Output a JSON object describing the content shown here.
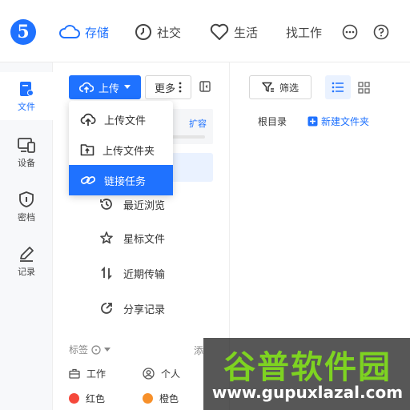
{
  "brand": {
    "logo_text": "5",
    "accent": "#1f72ff"
  },
  "nav": {
    "items": [
      {
        "label": "存储",
        "icon": "cloud-icon",
        "active": true
      },
      {
        "label": "社交",
        "icon": "clock-icon"
      },
      {
        "label": "生活",
        "icon": "heart-icon"
      },
      {
        "label": "找工作"
      }
    ],
    "more_icon": "more-dots-icon",
    "help_icon": "help-icon"
  },
  "rail": {
    "items": [
      {
        "label": "文件",
        "icon": "file-icon",
        "active": true
      },
      {
        "label": "设备",
        "icon": "devices-icon"
      },
      {
        "label": "密档",
        "icon": "shield-icon"
      },
      {
        "label": "记录",
        "icon": "pen-icon"
      }
    ]
  },
  "toolbar": {
    "upload_label": "上传",
    "more_label": "更多"
  },
  "upload_menu": {
    "items": [
      {
        "label": "上传文件",
        "icon": "cloud-upload-icon"
      },
      {
        "label": "上传文件夹",
        "icon": "folder-upload-icon"
      },
      {
        "label": "链接任务",
        "icon": "link-icon",
        "active": true
      }
    ]
  },
  "storage": {
    "expand_label": "扩容"
  },
  "side_menu": {
    "items": [
      {
        "label": "最近浏览",
        "icon": "history-icon"
      },
      {
        "label": "星标文件",
        "icon": "star-icon"
      },
      {
        "label": "近期传输",
        "icon": "transfer-icon"
      },
      {
        "label": "分享记录",
        "icon": "share-icon"
      }
    ]
  },
  "tags": {
    "header": "标签",
    "add_label": "添",
    "items": [
      {
        "label": "工作",
        "icon": "briefcase-icon"
      },
      {
        "label": "个人",
        "icon": "person-icon"
      },
      {
        "label": "红色",
        "color": "#f5483b"
      },
      {
        "label": "橙色",
        "color": "#f7902a"
      }
    ]
  },
  "main": {
    "filter_label": "筛选",
    "root_label": "根目录",
    "new_folder_label": "新建文件夹"
  },
  "watermark": {
    "title": "谷普软件园",
    "url": "www.gupuxlazal.com"
  }
}
